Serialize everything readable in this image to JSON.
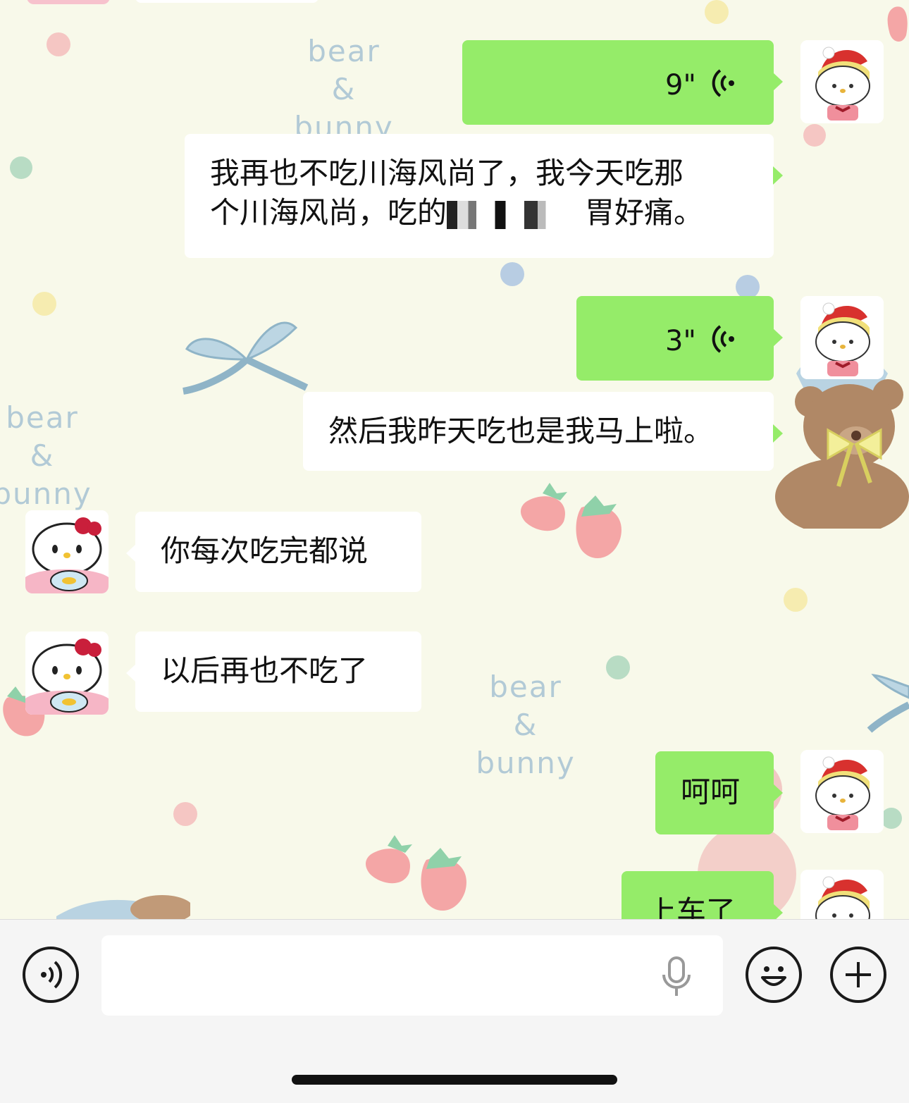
{
  "messages": [
    {
      "side": "out",
      "type": "voice",
      "duration": "9\""
    },
    {
      "side": "out",
      "type": "text",
      "line1": "我再也不吃川海风尚了，我今天吃那",
      "line2_before": "个川海风尚，吃的",
      "line2_after": "胃好痛。"
    },
    {
      "side": "out",
      "type": "voice",
      "duration": "3\""
    },
    {
      "side": "out",
      "type": "text",
      "text": "然后我昨天吃也是我马上啦。"
    },
    {
      "side": "in",
      "type": "text",
      "text": "你每次吃完都说"
    },
    {
      "side": "in",
      "type": "text",
      "text": "以后再也不吃了"
    },
    {
      "side": "out",
      "type": "text",
      "text": "呵呵"
    },
    {
      "side": "out",
      "type": "text",
      "text": "上车了"
    }
  ],
  "wallpaper": {
    "watermark": [
      "bear",
      "&",
      "bunny"
    ]
  },
  "input_bar": {
    "text_value": "",
    "icons": [
      "voice-mode-icon",
      "microphone-icon",
      "emoji-icon",
      "add-icon"
    ]
  },
  "colors": {
    "outgoing_bubble": "#95ec69",
    "incoming_bubble": "#ffffff",
    "background": "#f8f9ea"
  }
}
